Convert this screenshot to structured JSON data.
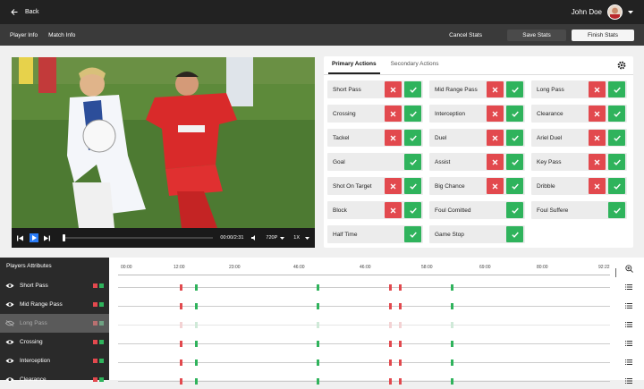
{
  "topbar": {
    "back_label": "Back",
    "user_name": "John Doe"
  },
  "secbar": {
    "player_info": "Player Info",
    "match_info": "Match Info",
    "cancel": "Cancel Stats",
    "save": "Save Stats",
    "finish": "Finish Stats"
  },
  "video": {
    "time": "00:00/2:31",
    "quality": "720P",
    "speed": "1X",
    "progress": 0.0
  },
  "panel": {
    "tabs": [
      "Primary Actions",
      "Secondary Actions"
    ],
    "actions": [
      {
        "label": "Short Pass",
        "x": true
      },
      {
        "label": "Mid Range Pass",
        "x": true
      },
      {
        "label": "Long Pass",
        "x": true
      },
      {
        "label": "Crossing",
        "x": true
      },
      {
        "label": "Interception",
        "x": true
      },
      {
        "label": "Clearance",
        "x": true
      },
      {
        "label": "Tackel",
        "x": true
      },
      {
        "label": "Duel",
        "x": true
      },
      {
        "label": "Ariel Duel",
        "x": true
      },
      {
        "label": "Goal",
        "x": false
      },
      {
        "label": "Assist",
        "x": true
      },
      {
        "label": "Key Pass",
        "x": true
      },
      {
        "label": "Shot On Target",
        "x": true
      },
      {
        "label": "Big Chance",
        "x": true
      },
      {
        "label": "Dribble",
        "x": true
      },
      {
        "label": "Block",
        "x": true
      },
      {
        "label": "Foul Comitted",
        "x": false
      },
      {
        "label": "Foul Suffere",
        "x": false
      },
      {
        "label": "Half Time",
        "x": false
      },
      {
        "label": "Game Stop",
        "x": false
      }
    ]
  },
  "attributes": {
    "title": "Players Attributes",
    "rows": [
      {
        "label": "Short Pass",
        "hidden": false
      },
      {
        "label": "Mid Range Pass",
        "hidden": false
      },
      {
        "label": "Long Pass",
        "hidden": true
      },
      {
        "label": "Crossing",
        "hidden": false
      },
      {
        "label": "Interception",
        "hidden": false
      },
      {
        "label": "Clearance",
        "hidden": false
      }
    ]
  },
  "timeline": {
    "ticks": [
      "00:00",
      "12:00",
      "23:00",
      "46:00",
      "46:00",
      "58:00",
      "69:00",
      "80:00",
      "92:22"
    ],
    "markers": [
      {
        "min": 10.5,
        "color": "red"
      },
      {
        "min": 13.5,
        "color": "green"
      },
      {
        "min": 37,
        "color": "green"
      },
      {
        "min": 51,
        "color": "red"
      },
      {
        "min": 53,
        "color": "red"
      },
      {
        "min": 63,
        "color": "green"
      }
    ]
  },
  "colors": {
    "accent_blue": "#2a7cf7",
    "red": "#e2494e",
    "green": "#2fb35c"
  }
}
